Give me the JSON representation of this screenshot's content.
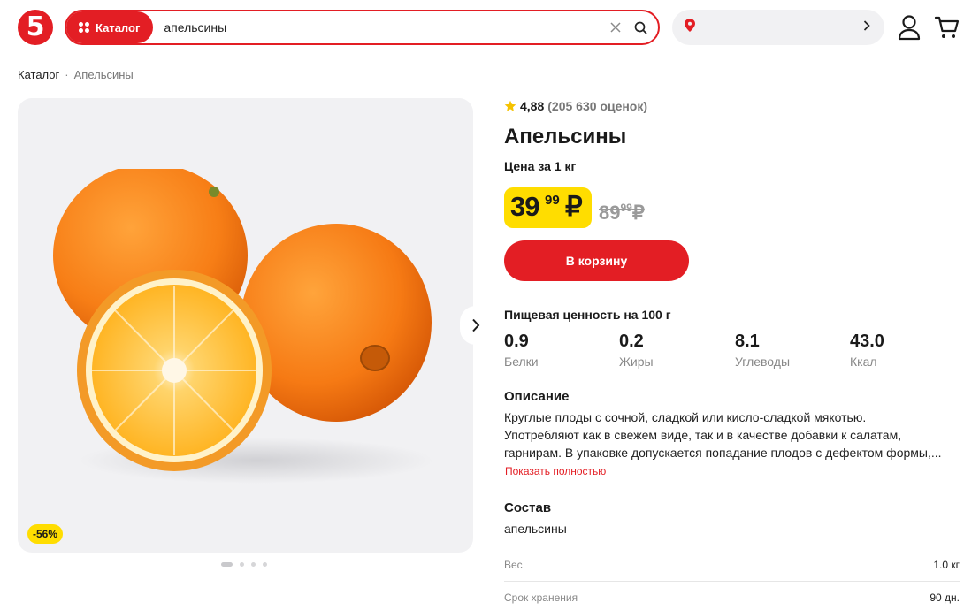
{
  "header": {
    "logo_text": "5",
    "catalog_label": "Каталог",
    "search_value": "апельсины",
    "location_value": ""
  },
  "breadcrumb": {
    "root": "Каталог",
    "separator": "·",
    "current": "Апельсины"
  },
  "gallery": {
    "discount_badge": "-56%",
    "slides_count": 4,
    "active_slide": 1
  },
  "product": {
    "rating_value": "4,88",
    "rating_count": "(205 630 оценок)",
    "title": "Апельсины",
    "unit_price_label": "Цена за 1 кг",
    "price_int": "39",
    "price_frac": "99",
    "currency": "₽",
    "old_price_int": "89",
    "old_price_frac": "99",
    "add_to_cart_label": "В корзину"
  },
  "nutrition": {
    "title": "Пищевая ценность на 100 г",
    "items": [
      {
        "value": "0.9",
        "label": "Белки"
      },
      {
        "value": "0.2",
        "label": "Жиры"
      },
      {
        "value": "8.1",
        "label": "Углеводы"
      },
      {
        "value": "43.0",
        "label": "Ккал"
      }
    ]
  },
  "description": {
    "title": "Описание",
    "lines": [
      "Круглые плоды с сочной, сладкой или кисло-сладкой мякотью.",
      "Употребляют как в свежем виде, так и в качестве добавки к салатам,",
      "гарнирам. В упаковке допускается попадание плодов с дефектом формы,..."
    ],
    "show_more": "Показать полностью"
  },
  "composition": {
    "title": "Состав",
    "text": "апельсины"
  },
  "specs": [
    {
      "label": "Вес",
      "value": "1.0 кг"
    },
    {
      "label": "Срок хранения",
      "value": "90 дн."
    }
  ],
  "colors": {
    "brand_red": "#e31e24",
    "price_yellow": "#ffdd00",
    "star_yellow": "#f5c200"
  }
}
